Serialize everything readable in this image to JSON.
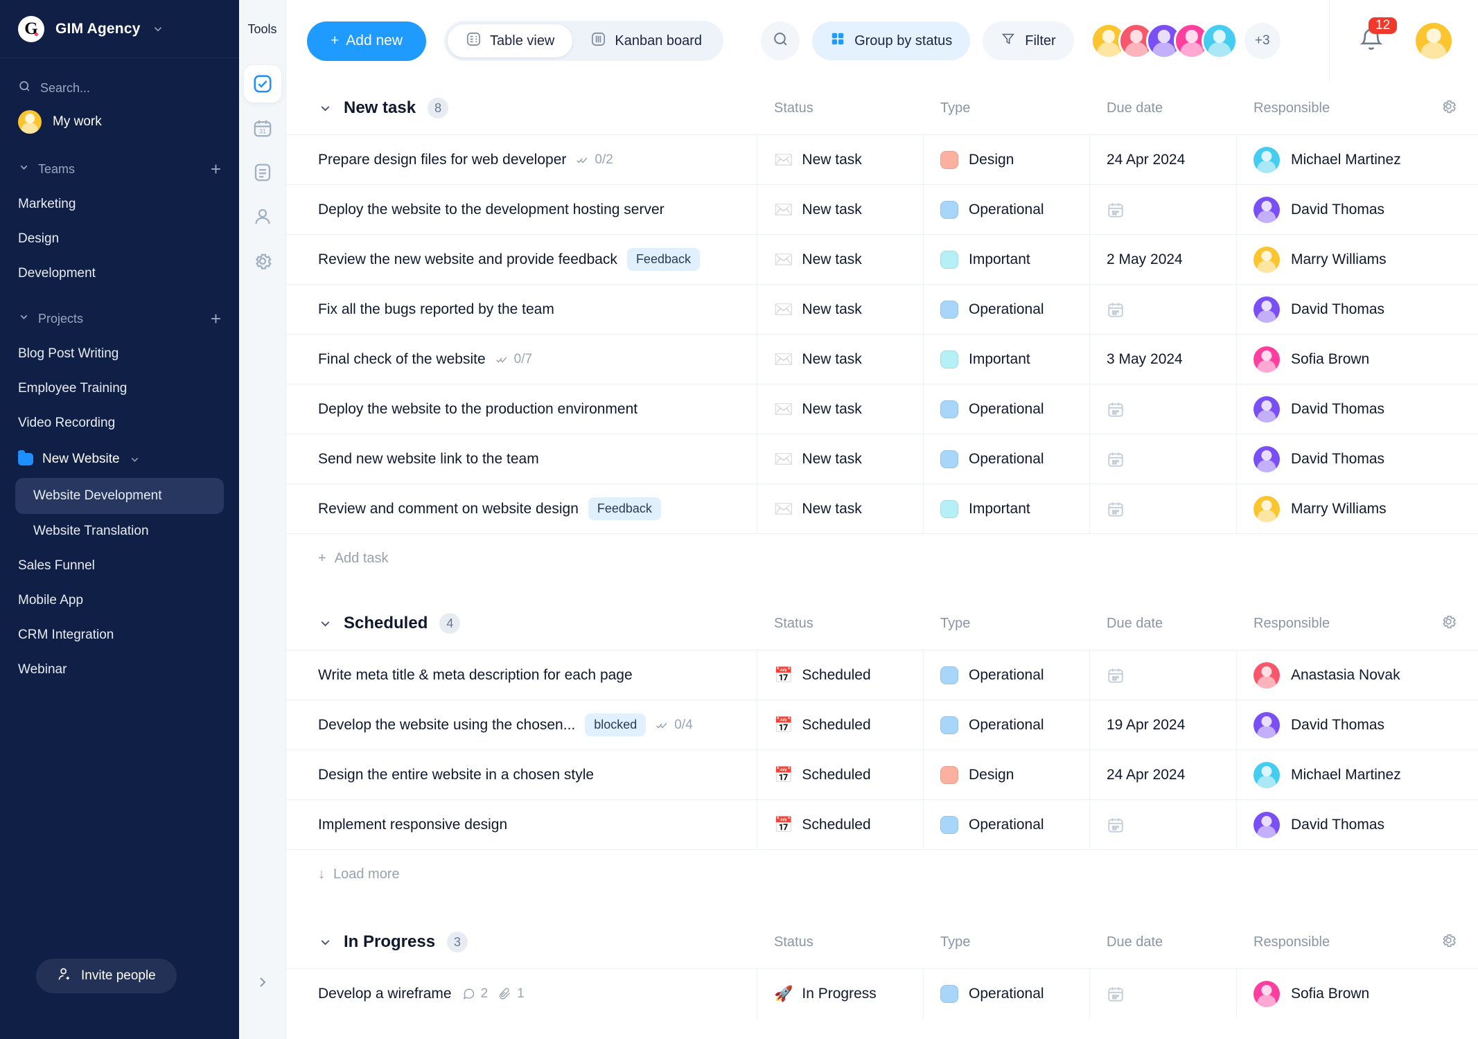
{
  "sidebar": {
    "brand": {
      "logo_letter": "G",
      "name": "GIM Agency",
      "chevron": "chevron-down"
    },
    "search_placeholder": "Search...",
    "my_work": "My work",
    "teams": {
      "label": "Teams",
      "add": "+",
      "items": [
        "Marketing",
        "Design",
        "Development"
      ]
    },
    "projects": {
      "label": "Projects",
      "add": "+",
      "items": [
        "Blog Post Writing",
        "Employee Training",
        "Video Recording"
      ],
      "folder": {
        "name": "New Website",
        "children": [
          "Website Development",
          "Website Translation"
        ],
        "active": "Website Development"
      },
      "after": [
        "Sales Funnel",
        "Mobile App",
        "CRM Integration",
        "Webinar"
      ]
    },
    "invite_label": "Invite people"
  },
  "rail": {
    "label": "Tools",
    "icons": [
      "tasks-check-icon",
      "calendar-31-icon",
      "document-icon",
      "person-icon",
      "gear-icon"
    ],
    "expand": "chevron-right-icon"
  },
  "topbar": {
    "add_new": "Add new",
    "views": [
      {
        "label": "Table view",
        "icon": "table-icon",
        "active": true
      },
      {
        "label": "Kanban board",
        "icon": "kanban-icon",
        "active": false
      }
    ],
    "search_icon": "search-icon",
    "group_by": "Group by status",
    "filter": "Filter",
    "avatar_overflow": "+3",
    "notification_count": "12",
    "avatar_colors": [
      "#fcc52f",
      "#f8576b",
      "#7a4ff5",
      "#ff3f9e",
      "#44cdf0"
    ]
  },
  "columns": {
    "task": "",
    "status": "Status",
    "type": "Type",
    "due": "Due date",
    "responsible": "Responsible"
  },
  "colors": {
    "accent": "#1f9bff",
    "sidebar_bg": "#101f45",
    "type_design": "#fbb0a0",
    "type_operational": "#a8d5fa",
    "type_important": "#b6f0f7",
    "badge_red": "#f0392b",
    "chip_bg": "#e1f0fd"
  },
  "groups": [
    {
      "title": "New task",
      "count": "8",
      "footer": {
        "type": "add",
        "label": "Add task"
      },
      "rows": [
        {
          "task": "Prepare design files for web developer",
          "subtasks": "0/2",
          "chip": "",
          "status": "New task",
          "status_icon": "envelope",
          "type": "Design",
          "type_color": "#fbb0a0",
          "due": "24 Apr 2024",
          "responsible": "Michael Martinez",
          "avatar_color": "#44cdf0"
        },
        {
          "task": "Deploy the website to the development hosting server",
          "subtasks": "",
          "chip": "",
          "status": "New task",
          "status_icon": "envelope",
          "type": "Operational",
          "type_color": "#a8d5fa",
          "due": "",
          "responsible": "David Thomas",
          "avatar_color": "#7a4ff5"
        },
        {
          "task": "Review the new website and provide feedback",
          "subtasks": "",
          "chip": "Feedback",
          "status": "New task",
          "status_icon": "envelope",
          "type": "Important",
          "type_color": "#b6f0f7",
          "due": "2 May 2024",
          "responsible": "Marry Williams",
          "avatar_color": "#fcc52f"
        },
        {
          "task": "Fix all the bugs reported by the team",
          "subtasks": "",
          "chip": "",
          "status": "New task",
          "status_icon": "envelope",
          "type": "Operational",
          "type_color": "#a8d5fa",
          "due": "",
          "responsible": "David Thomas",
          "avatar_color": "#7a4ff5"
        },
        {
          "task": "Final check of the website",
          "subtasks": "0/7",
          "chip": "",
          "status": "New task",
          "status_icon": "envelope",
          "type": "Important",
          "type_color": "#b6f0f7",
          "due": "3 May 2024",
          "responsible": "Sofia Brown",
          "avatar_color": "#ff3f9e"
        },
        {
          "task": "Deploy the website to the production environment",
          "subtasks": "",
          "chip": "",
          "status": "New task",
          "status_icon": "envelope",
          "type": "Operational",
          "type_color": "#a8d5fa",
          "due": "",
          "responsible": "David Thomas",
          "avatar_color": "#7a4ff5"
        },
        {
          "task": "Send new website link to the team",
          "subtasks": "",
          "chip": "",
          "status": "New task",
          "status_icon": "envelope",
          "type": "Operational",
          "type_color": "#a8d5fa",
          "due": "",
          "responsible": "David Thomas",
          "avatar_color": "#7a4ff5"
        },
        {
          "task": "Review and comment on website design",
          "subtasks": "",
          "chip": "Feedback",
          "status": "New task",
          "status_icon": "envelope",
          "type": "Important",
          "type_color": "#b6f0f7",
          "due": "",
          "responsible": "Marry Williams",
          "avatar_color": "#fcc52f"
        }
      ]
    },
    {
      "title": "Scheduled",
      "count": "4",
      "footer": {
        "type": "load",
        "label": "Load more"
      },
      "rows": [
        {
          "task": "Write meta title & meta description for each page",
          "subtasks": "",
          "chip": "",
          "status": "Scheduled",
          "status_icon": "calendar",
          "type": "Operational",
          "type_color": "#a8d5fa",
          "due": "",
          "responsible": "Anastasia Novak",
          "avatar_color": "#f8576b"
        },
        {
          "task": "Develop the website using the chosen...",
          "subtasks": "0/4",
          "chip": "blocked",
          "status": "Scheduled",
          "status_icon": "calendar",
          "type": "Operational",
          "type_color": "#a8d5fa",
          "due": "19 Apr 2024",
          "responsible": "David Thomas",
          "avatar_color": "#7a4ff5"
        },
        {
          "task": "Design the entire website in a chosen style",
          "subtasks": "",
          "chip": "",
          "status": "Scheduled",
          "status_icon": "calendar",
          "type": "Design",
          "type_color": "#fbb0a0",
          "due": "24 Apr 2024",
          "responsible": "Michael Martinez",
          "avatar_color": "#44cdf0"
        },
        {
          "task": "Implement responsive design",
          "subtasks": "",
          "chip": "",
          "status": "Scheduled",
          "status_icon": "calendar",
          "type": "Operational",
          "type_color": "#a8d5fa",
          "due": "",
          "responsible": "David Thomas",
          "avatar_color": "#7a4ff5"
        }
      ]
    },
    {
      "title": "In Progress",
      "count": "3",
      "footer": null,
      "rows": [
        {
          "task": "Develop a wireframe",
          "subtasks": "",
          "comments": "2",
          "attachments": "1",
          "chip": "",
          "status": "In Progress",
          "status_icon": "rocket",
          "type": "Operational",
          "type_color": "#a8d5fa",
          "due": "",
          "responsible": "Sofia Brown",
          "avatar_color": "#ff3f9e"
        }
      ]
    }
  ]
}
